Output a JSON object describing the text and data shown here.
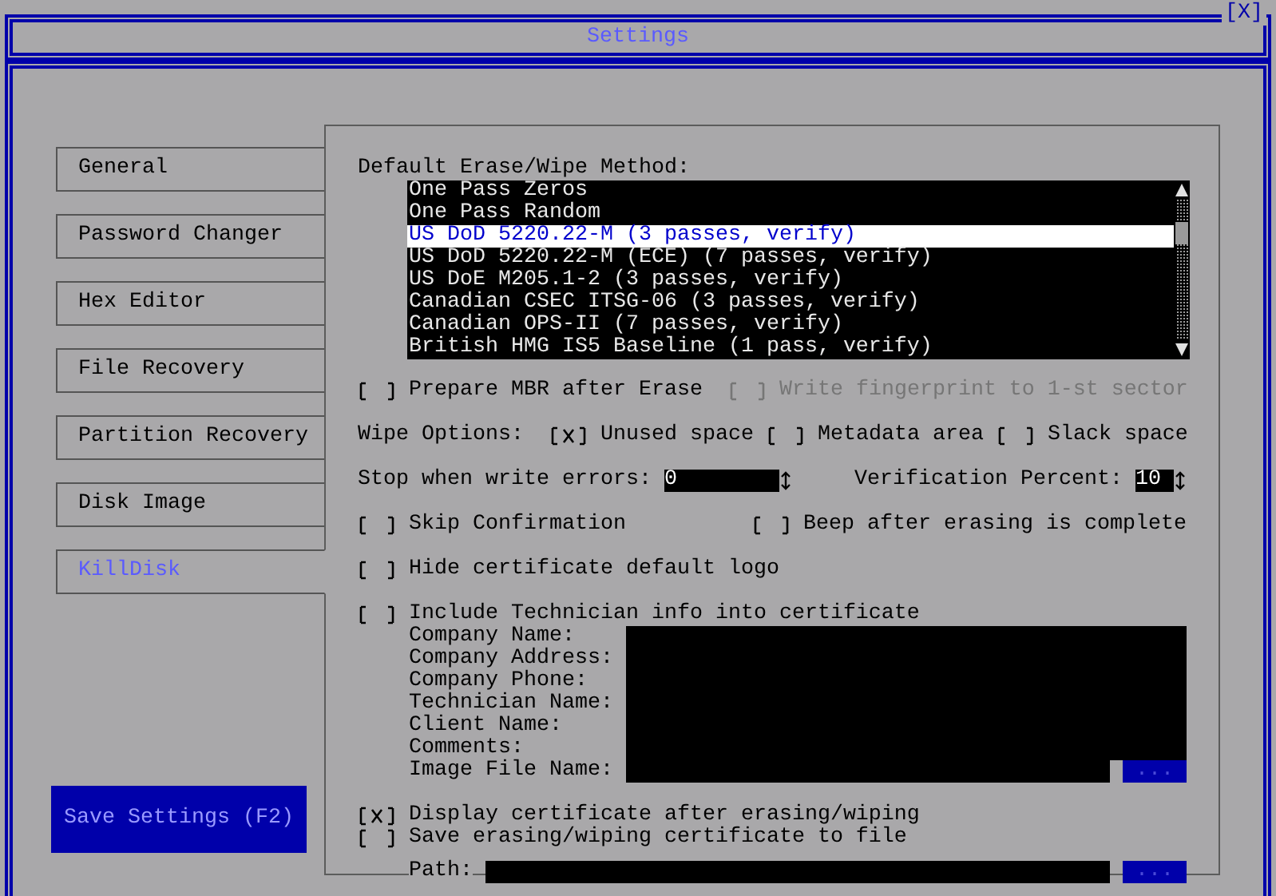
{
  "window": {
    "title": "Settings",
    "close": "[X]"
  },
  "sidebar": {
    "items": [
      {
        "label": "General",
        "selected": false
      },
      {
        "label": "Password Changer",
        "selected": false
      },
      {
        "label": "Hex Editor",
        "selected": false
      },
      {
        "label": "File Recovery",
        "selected": false
      },
      {
        "label": "Partition Recovery",
        "selected": false
      },
      {
        "label": "Disk Image",
        "selected": false
      },
      {
        "label": "KillDisk",
        "selected": true
      }
    ]
  },
  "save_button": "Save Settings (F2)",
  "erase_method": {
    "label": "Default Erase/Wipe Method:",
    "options": [
      {
        "label": "One Pass Zeros",
        "selected": false
      },
      {
        "label": "One Pass Random",
        "selected": false
      },
      {
        "label": "US DoD 5220.22-M (3 passes, verify)",
        "selected": true
      },
      {
        "label": "US DoD 5220.22-M (ECE) (7 passes, verify)",
        "selected": false
      },
      {
        "label": "US DoE M205.1-2 (3 passes, verify)",
        "selected": false
      },
      {
        "label": "Canadian CSEC ITSG-06 (3 passes, verify)",
        "selected": false
      },
      {
        "label": "Canadian OPS-II (7 passes, verify)",
        "selected": false
      },
      {
        "label": "British HMG IS5 Baseline (1 pass, verify)",
        "selected": false
      }
    ]
  },
  "prepare_mbr": {
    "label": "Prepare MBR after Erase",
    "checked": false
  },
  "write_fingerprint": {
    "label": "Write fingerprint to 1-st sector",
    "checked": false,
    "disabled": true
  },
  "wipe_options": {
    "label": "Wipe Options:",
    "items": [
      {
        "label": "Unused space",
        "checked": true
      },
      {
        "label": "Metadata area",
        "checked": false
      },
      {
        "label": "Slack space",
        "checked": false
      }
    ]
  },
  "stop_errors": {
    "label": "Stop when write errors:",
    "value": "0"
  },
  "verification": {
    "label": "Verification Percent:",
    "value": "10"
  },
  "skip_confirmation": {
    "label": "Skip Confirmation",
    "checked": false
  },
  "beep": {
    "label": "Beep after erasing is complete",
    "checked": false
  },
  "hide_logo": {
    "label": "Hide certificate default logo",
    "checked": false
  },
  "include_technician": {
    "label": "Include Technician info into certificate",
    "checked": false
  },
  "technician_fields": [
    {
      "label": "Company Name:"
    },
    {
      "label": "Company Address:"
    },
    {
      "label": "Company Phone:"
    },
    {
      "label": "Technician Name:"
    },
    {
      "label": "Client Name:"
    },
    {
      "label": "Comments:"
    },
    {
      "label": "Image File Name:"
    }
  ],
  "image_browse": "...",
  "display_certificate": {
    "label": "Display certificate after erasing/wiping",
    "checked": true
  },
  "save_certificate": {
    "label": "Save erasing/wiping certificate to file",
    "checked": false
  },
  "path": {
    "label": "Path:",
    "browse": "..."
  }
}
